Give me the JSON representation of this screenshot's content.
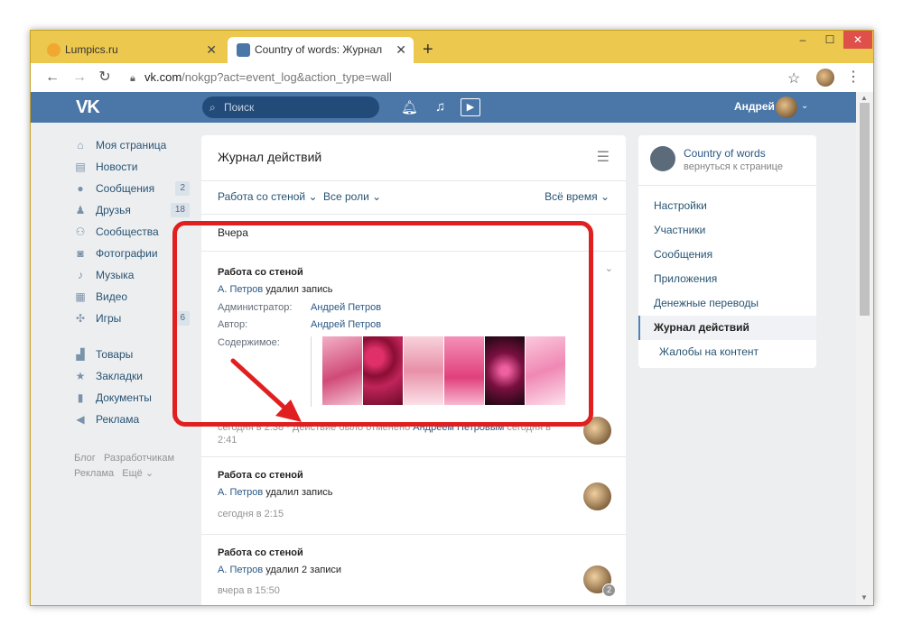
{
  "browser": {
    "tabs": [
      {
        "title": "Lumpics.ru",
        "favicon": "lumpics-icon",
        "close": "✕"
      },
      {
        "title": "Country of words: Журнал дейст",
        "favicon": "vk-icon",
        "close": "✕"
      }
    ],
    "new_tab": "+",
    "url_host": "vk.com",
    "url_path": "/nokgp?act=event_log&action_type=wall",
    "window_controls": [
      "–",
      "☐",
      "✕"
    ]
  },
  "header": {
    "logo": "VK",
    "search_placeholder": "Поиск",
    "user_name": "Андрей",
    "brand_color": "#4a76a8"
  },
  "left_menu": {
    "items": [
      {
        "label": "Моя страница",
        "icon": "home-icon",
        "count": ""
      },
      {
        "label": "Новости",
        "icon": "news-icon",
        "count": ""
      },
      {
        "label": "Сообщения",
        "icon": "messages-icon",
        "count": "2"
      },
      {
        "label": "Друзья",
        "icon": "friends-icon",
        "count": "18"
      },
      {
        "label": "Сообщества",
        "icon": "communities-icon",
        "count": ""
      },
      {
        "label": "Фотографии",
        "icon": "photos-icon",
        "count": ""
      },
      {
        "label": "Музыка",
        "icon": "music-icon",
        "count": ""
      },
      {
        "label": "Видео",
        "icon": "video-icon",
        "count": ""
      },
      {
        "label": "Игры",
        "icon": "games-icon",
        "count": "6"
      }
    ],
    "items2": [
      {
        "label": "Товары",
        "icon": "goods-icon"
      },
      {
        "label": "Закладки",
        "icon": "bookmarks-icon"
      },
      {
        "label": "Документы",
        "icon": "documents-icon"
      },
      {
        "label": "Реклама",
        "icon": "ads-icon"
      }
    ],
    "footer": {
      "blog": "Блог",
      "dev": "Разработчикам",
      "ads": "Реклама",
      "more": "Ещё"
    }
  },
  "main": {
    "title": "Журнал действий",
    "filters": {
      "type": "Работа со стеной",
      "roles": "Все роли",
      "period": "Всё время"
    },
    "day": "Вчера",
    "entries": [
      {
        "title": "Работа со стеной",
        "actor": "А. Петров",
        "action": " удалил запись",
        "admin_label": "Администратор:",
        "admin": "Андрей Петров",
        "author_label": "Автор:",
        "author": "Андрей Петров",
        "content_label": "Содержимое:",
        "time": "сегодня в 2:38",
        "cancel_text": " · Действие было отменено ",
        "canceled_by": "Андреем Петровым",
        "cancel_time_1": " сегодня в",
        "cancel_time_2": "2:41"
      },
      {
        "title": "Работа со стеной",
        "actor": "А. Петров",
        "action": " удалил запись",
        "time": "сегодня в 2:15"
      },
      {
        "title": "Работа со стеной",
        "actor": "А. Петров",
        "action": " удалил 2 записи",
        "time": "вчера в 15:50",
        "badge": "2"
      }
    ]
  },
  "right_panel": {
    "group_name": "Country of words",
    "back": "вернуться к странице",
    "items": [
      "Настройки",
      "Участники",
      "Сообщения",
      "Приложения",
      "Денежные переводы",
      "Журнал действий",
      "Жалобы на контент"
    ],
    "active_index": 5
  },
  "accent_colors": {
    "highlight": "#e02020",
    "link": "#2a5885"
  }
}
